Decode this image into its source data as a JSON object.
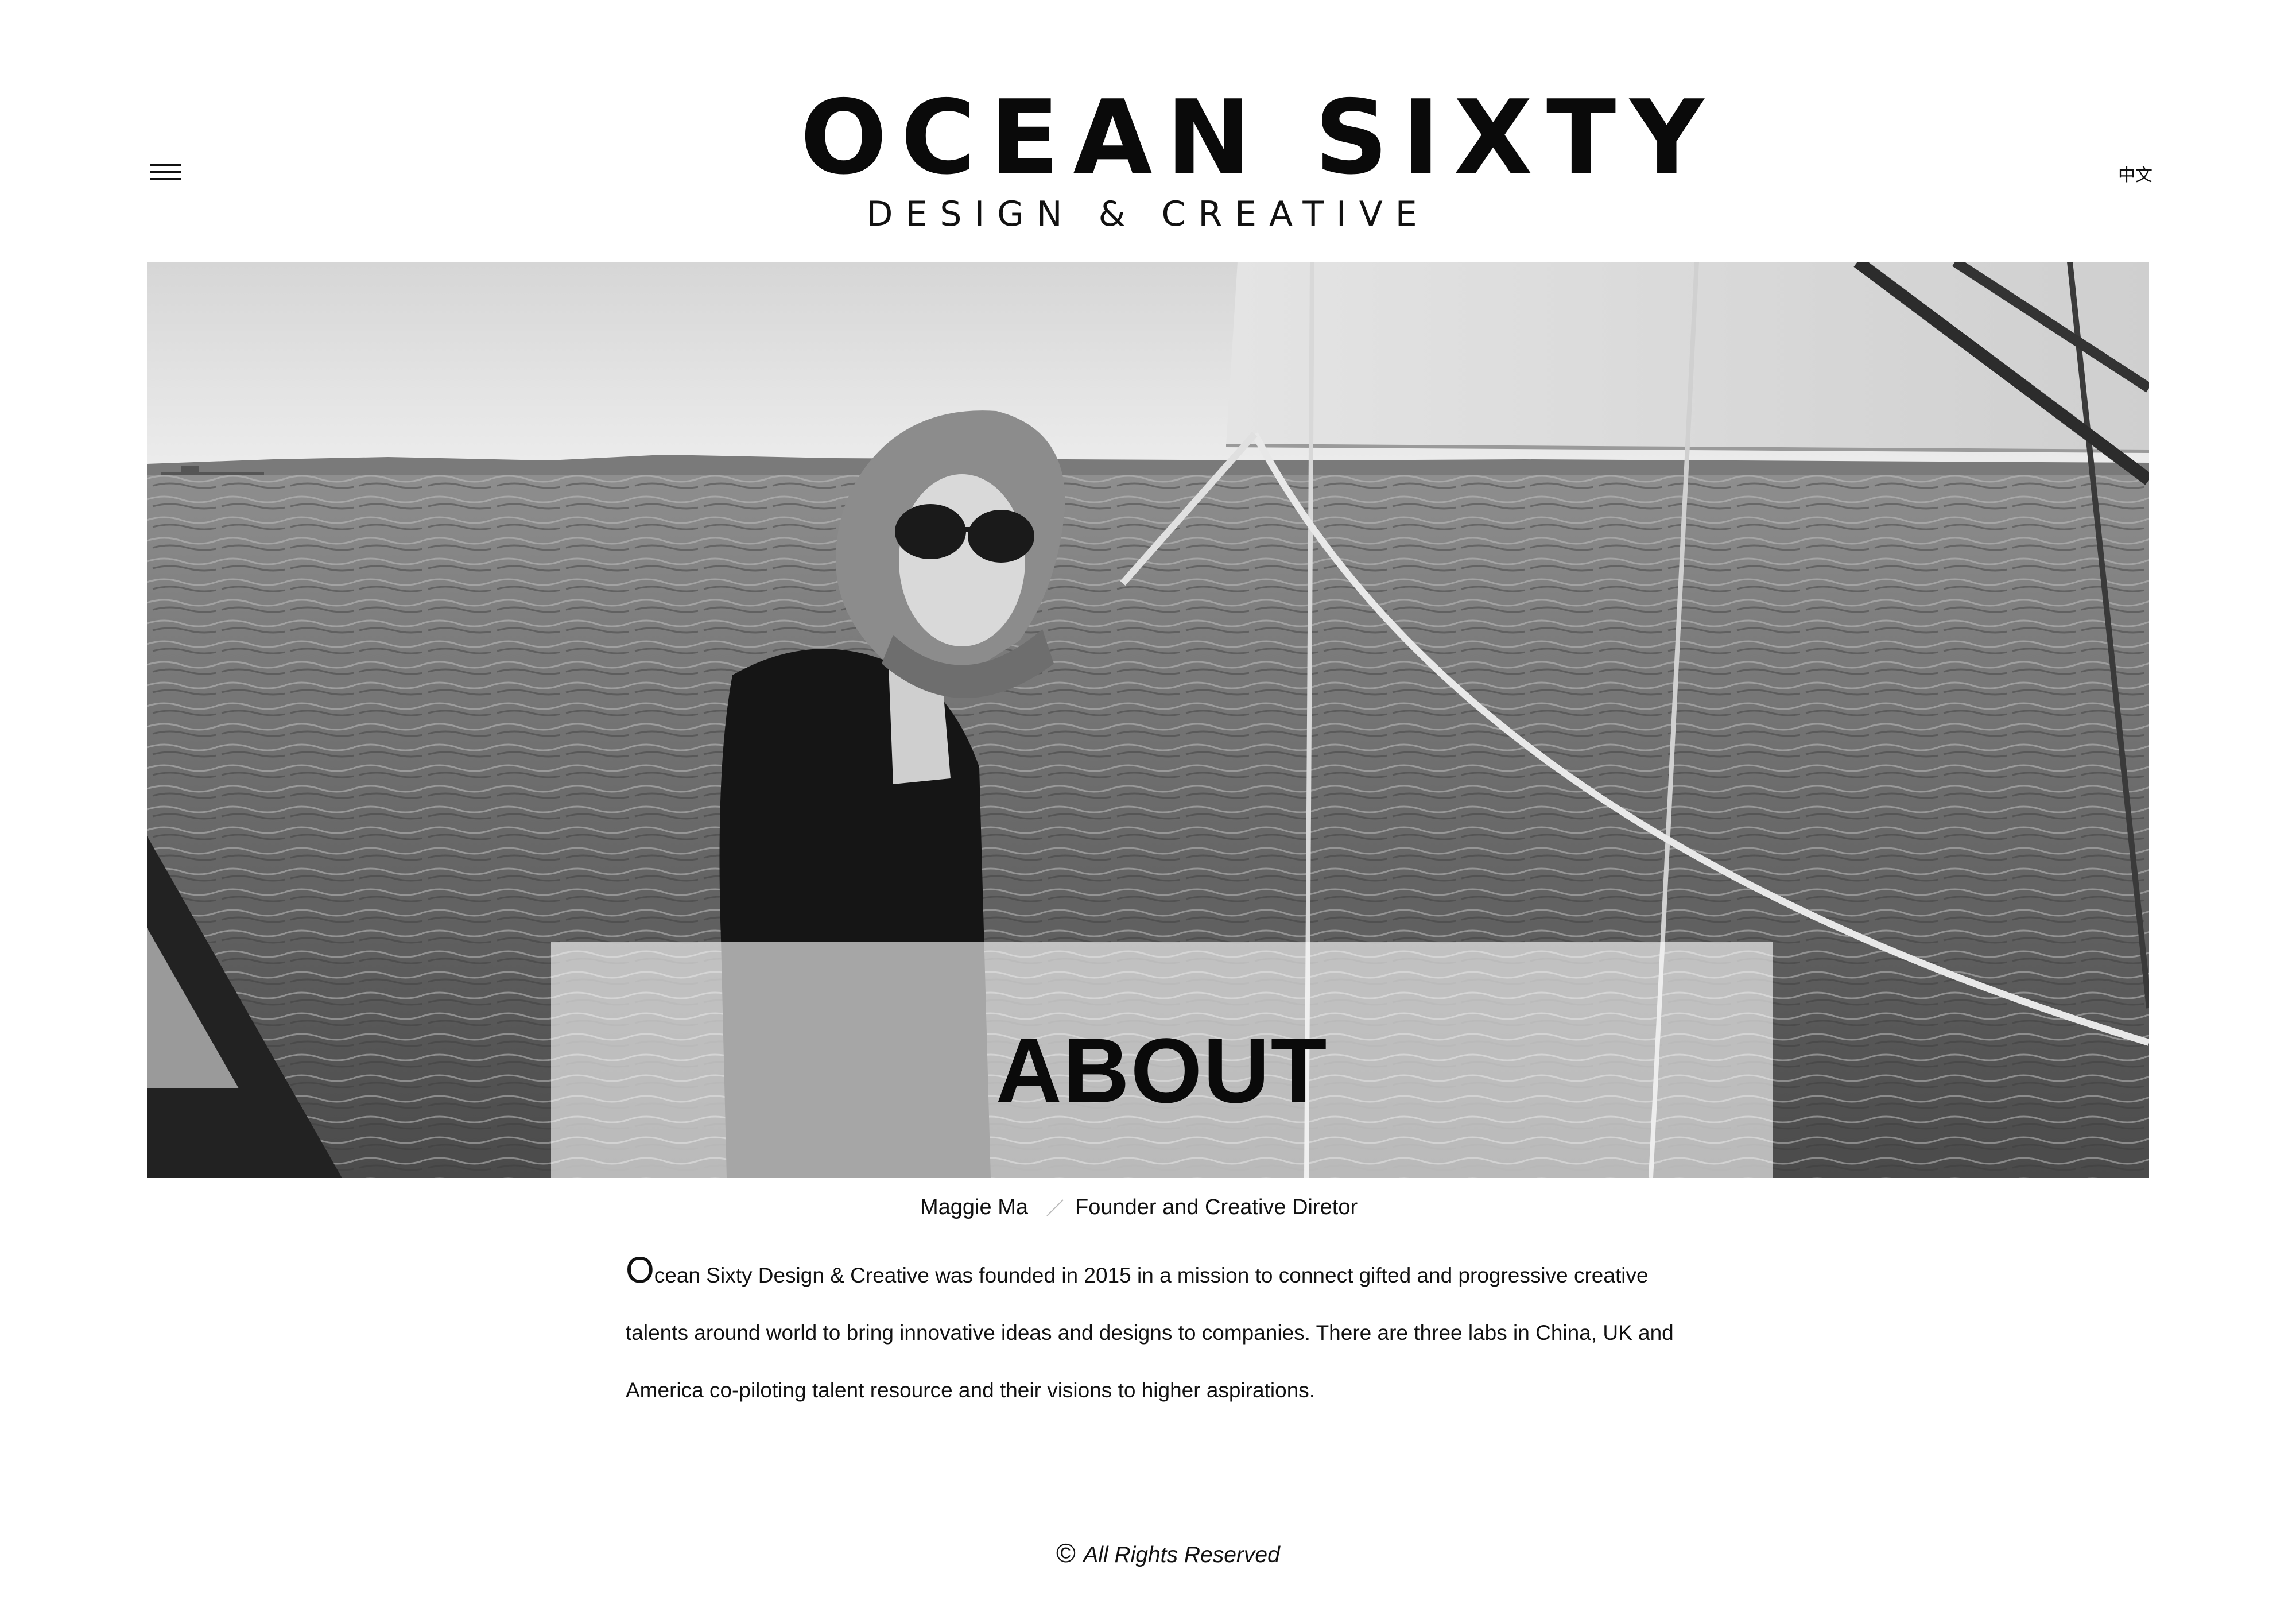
{
  "header": {
    "logo_title": "OCEAN SIXTY",
    "logo_subtitle": "DESIGN & CREATIVE",
    "menu_icon": "hamburger-menu-icon",
    "language_link": "中文"
  },
  "hero": {
    "heading": "ABOUT",
    "photo_subject": "black-and-white photo of a woman in a headscarf and sunglasses on a sailboat"
  },
  "caption": {
    "name": "Maggie Ma",
    "role": "Founder and Creative Diretor"
  },
  "intro": {
    "first_letter": "O",
    "text": "cean Sixty Design & Creative was founded in 2015 in a mission to connect gifted and progressive creative talents around world to bring innovative ideas and designs to companies. There are three labs in China, UK and America co-piloting talent resource and their visions to higher aspirations."
  },
  "footer": {
    "copyright_symbol": "©",
    "text": "All Rights Reserved"
  }
}
